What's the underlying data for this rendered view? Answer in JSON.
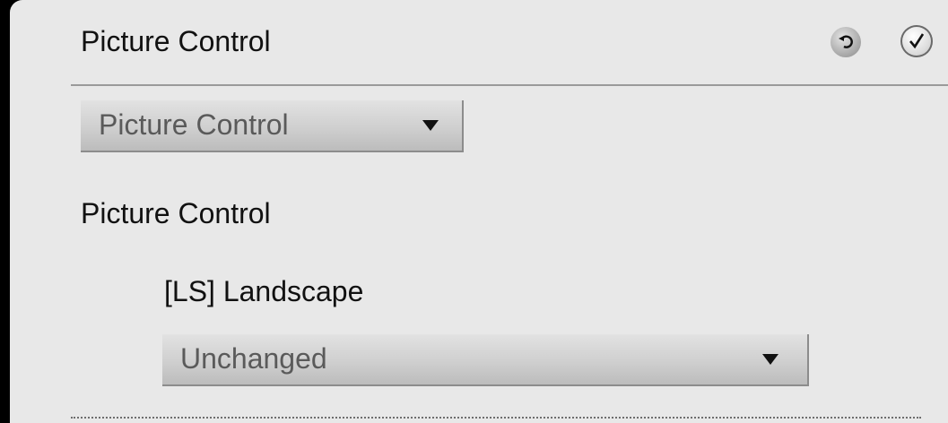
{
  "header": {
    "title": "Picture Control",
    "reset_icon": "undo-arrow-icon",
    "confirm_icon": "checkmark-icon"
  },
  "mode_dropdown": {
    "value": "Picture Control"
  },
  "section": {
    "heading": "Picture Control",
    "item_label": "[LS] Landscape",
    "item_dropdown": {
      "value": "Unchanged"
    }
  },
  "colors": {
    "panel_background": "#e8e8e8",
    "frame_background": "#000000",
    "text": "#111111",
    "dropdown_text": "#5a5a5a"
  }
}
